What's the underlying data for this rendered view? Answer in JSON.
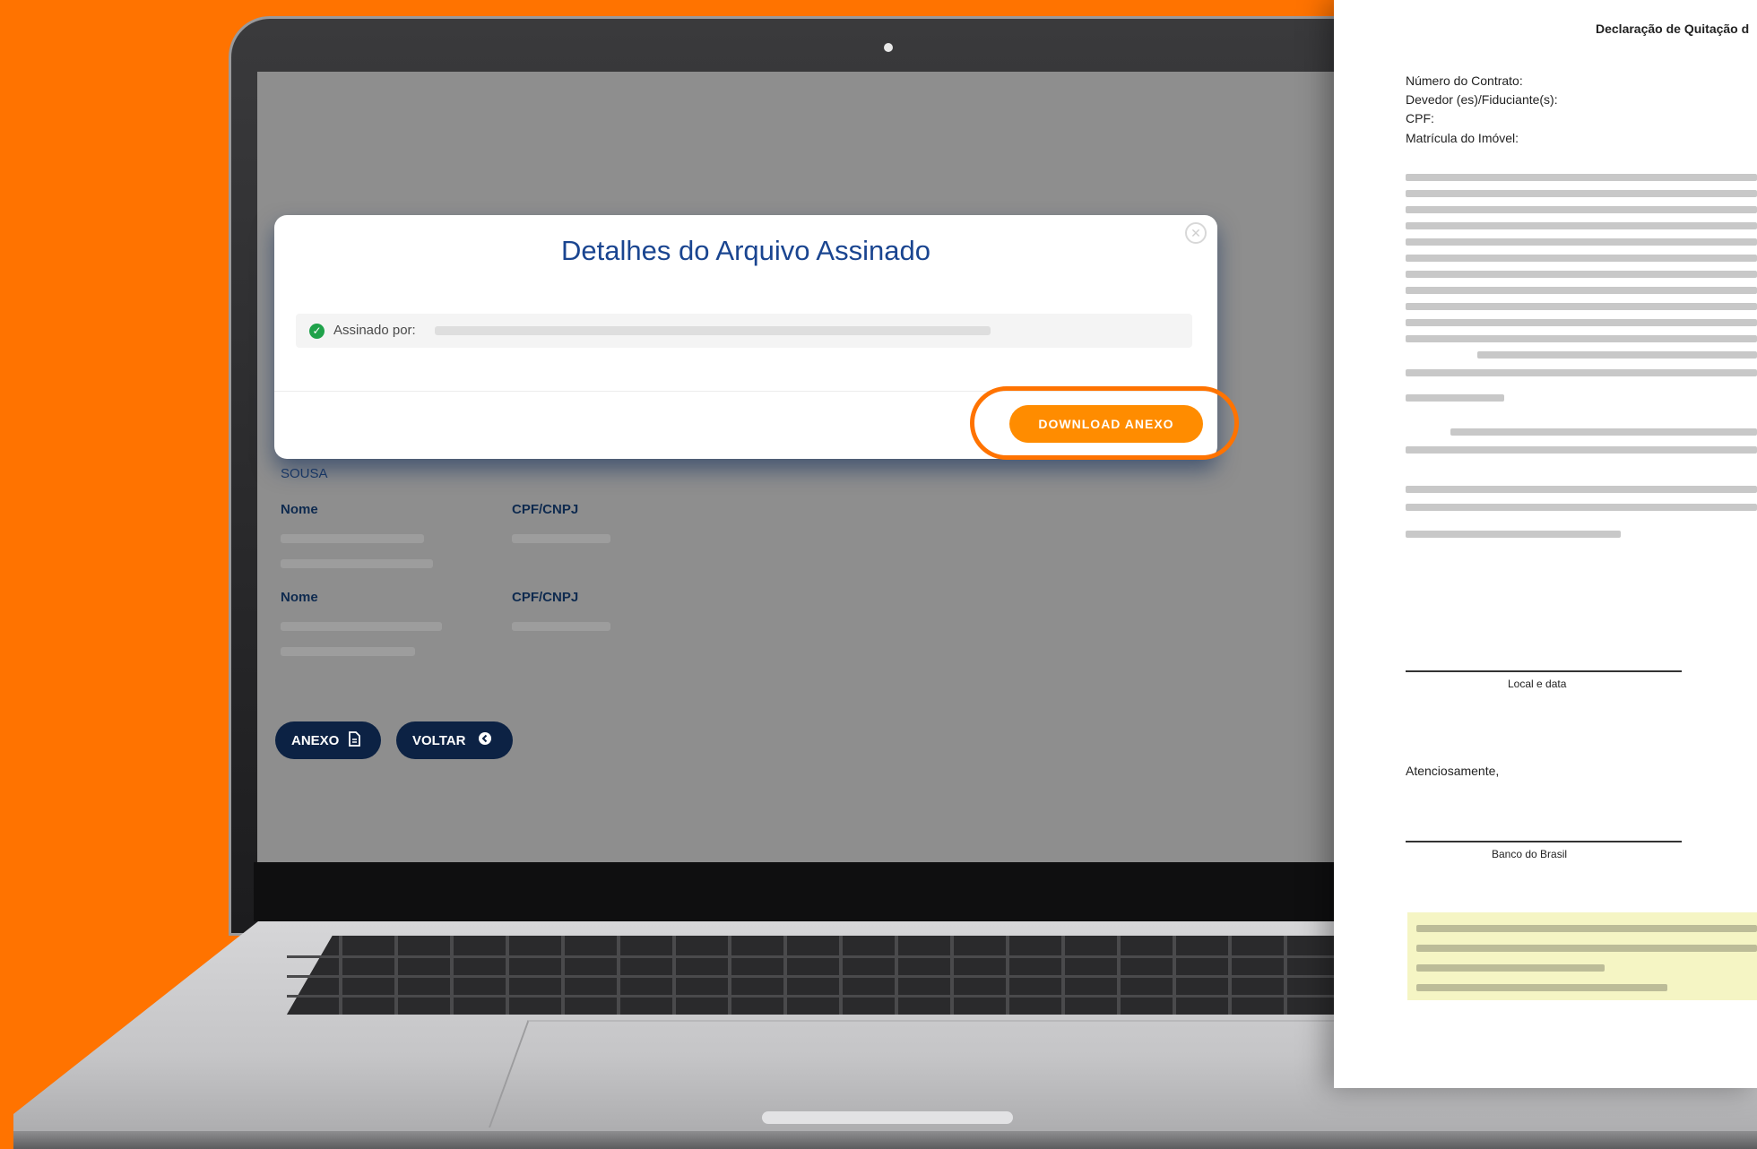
{
  "screen": {
    "partial_text": "SOUSA",
    "parties": [
      {
        "name_label": "Nome",
        "doc_label": "CPF/CNPJ"
      },
      {
        "name_label": "Nome",
        "doc_label": "CPF/CNPJ"
      }
    ],
    "buttons": {
      "anexo": "ANEXO",
      "voltar": "VOLTAR"
    }
  },
  "modal": {
    "title": "Detalhes do Arquivo Assinado",
    "signed_by_label": "Assinado por:",
    "download_label": "DOWNLOAD ANEXO"
  },
  "document": {
    "title": "Declaração de Quitação d",
    "contract_label": "Número do Contrato:",
    "debtor_label": "Devedor (es)/Fiduciante(s):",
    "cpf_label": "CPF:",
    "registry_label": "Matrícula do Imóvel:",
    "place_date_caption": "Local e data",
    "regards": "Atenciosamente,",
    "bank_caption": "Banco do Brasil"
  },
  "colors": {
    "background": "#ff7300",
    "accent": "#ff8c00",
    "navy": "#0c2244",
    "title_blue": "#1a4590",
    "success": "#1fa24a"
  }
}
